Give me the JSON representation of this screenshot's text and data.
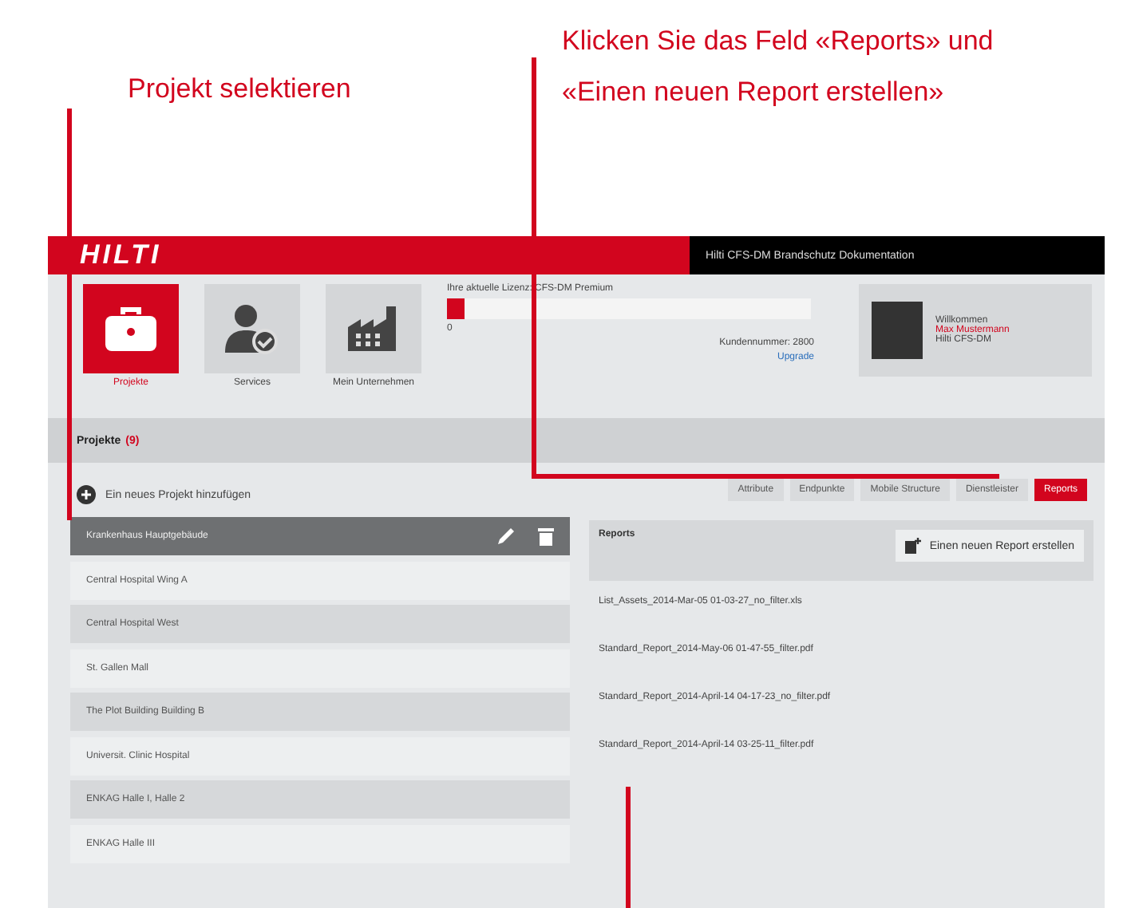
{
  "annotations": [
    {
      "text": "Projekt selektieren"
    },
    {
      "text": "Klicken Sie das Feld «Reports» und «Einen neuen Report erstellen»"
    }
  ],
  "top_bar": {
    "logo": "HILTI",
    "title": "Hilti CFS-DM Brandschutz Dokumentation"
  },
  "nav": [
    {
      "label": "Projekte",
      "selected": true
    },
    {
      "label": "Services",
      "selected": false
    },
    {
      "label": "Mein Unternehmen",
      "selected": false
    }
  ],
  "license": {
    "label": "Ihre aktuelle Lizenz: CFS-DM Premium",
    "level": 0.05,
    "reading": "0",
    "number": "Kundennummer: 2800",
    "link": "Upgrade"
  },
  "profile": {
    "greeting": "Willkommen",
    "name": "Max Mustermann",
    "company": "Hilti CFS-DM"
  },
  "section": {
    "title": "Projekte",
    "count": "(9)"
  },
  "add_project": "Ein neues Projekt hinzufügen",
  "projects": [
    {
      "name": "Krankenhaus Hauptgebäude",
      "selected": true
    },
    {
      "name": "Central Hospital Wing A",
      "selected": false
    },
    {
      "name": "Central Hospital West",
      "selected": false
    },
    {
      "name": "St. Gallen Mall",
      "selected": false
    },
    {
      "name": "The Plot Building Building B",
      "selected": false
    },
    {
      "name": "Universit. Clinic Hospital",
      "selected": false
    },
    {
      "name": "ENKAG Halle I, Halle 2",
      "selected": false
    },
    {
      "name": "ENKAG Halle III",
      "selected": false
    }
  ],
  "tabs": [
    {
      "label": "Attribute",
      "selected": false
    },
    {
      "label": "Endpunkte",
      "selected": false
    },
    {
      "label": "Mobile Structure",
      "selected": false
    },
    {
      "label": "Dienstleister",
      "selected": false
    },
    {
      "label": "Reports",
      "selected": true
    }
  ],
  "reports": {
    "title": "Reports",
    "new_button": "Einen neuen Report erstellen",
    "files": [
      "List_Assets_2014-Mar-05 01-03-27_no_filter.xls",
      "Standard_Report_2014-May-06 01-47-55_filter.pdf",
      "Standard_Report_2014-April-14 04-17-23_no_filter.pdf",
      "Standard_Report_2014-April-14 03-25-11_filter.pdf"
    ]
  }
}
